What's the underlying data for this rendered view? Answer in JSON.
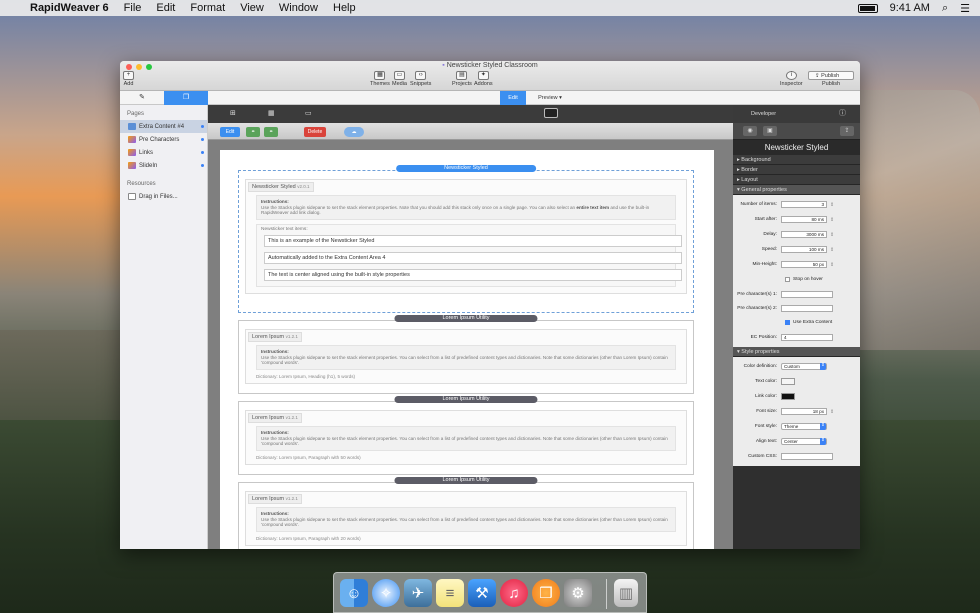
{
  "menubar": {
    "app": "RapidWeaver 6",
    "items": [
      "File",
      "Edit",
      "Format",
      "View",
      "Window",
      "Help"
    ],
    "clock": "9:41 AM"
  },
  "window": {
    "title": "Newsticker Styled Classroom",
    "toolbar": {
      "add": "Add",
      "themes": "Themes",
      "media": "Media",
      "snippets": "Snippets",
      "projects": "Projects",
      "addons": "Addons",
      "inspector": "Inspector",
      "publish": "Publish",
      "publish_button": "Publish"
    },
    "mode_tabs": {
      "edit": "Edit",
      "preview": "Preview"
    }
  },
  "sidebar": {
    "pages_header": "Pages",
    "pages": [
      {
        "label": "Extra Content #4",
        "color": "#5b8fd6"
      },
      {
        "label": "Pre Characters",
        "color": "#8b5cf6"
      },
      {
        "label": "Links",
        "color": "#8b5cf6"
      },
      {
        "label": "SlideIn",
        "color": "#8b5cf6"
      }
    ],
    "resources_header": "Resources",
    "drag_in": "Drag in Files..."
  },
  "stacks_toolbar": {
    "edit": "Edit",
    "delete": "Delete"
  },
  "stacks": [
    {
      "label": "Newsticker Styled",
      "title": "Newsticker Styled",
      "version": "v2.0.1",
      "instr_head": "Instructions:",
      "instr_1": "Use the Stacks plugin sidepane to set the stack element properties. Note that you should add this stack only once on a single page. You can also select an ",
      "instr_bold": "entire text item",
      "instr_2": " and use the built-in RapidWeaver add link dialog.",
      "items_head": "Newsticker text items:",
      "items": [
        "This is an example of the Newsticker Styled",
        "Automatically added to the Extra Content Area 4",
        "The text is center aligned using the built-in style properties"
      ]
    },
    {
      "label": "Lorem Ipsum Utility",
      "title": "Lorem Ipsum",
      "version": "v1.2.1",
      "instr_head": "Instructions:",
      "instr": "Use the Stacks plugin sidepane to set the stack element properties. You can select from a list of predefined content types and dictionaries. Note that some dictionaries (other than Lorem Ipsum) contain 'compound words'.",
      "dict": "Dictionary: Lorem Ipsum, Heading (h1), 5 words)"
    },
    {
      "label": "Lorem Ipsum Utility",
      "title": "Lorem Ipsum",
      "version": "v1.2.1",
      "instr_head": "Instructions:",
      "instr": "Use the Stacks plugin sidepane to set the stack element properties. You can select from a list of predefined content types and dictionaries. Note that some dictionaries (other than Lorem Ipsum) contain 'compound words'.",
      "dict": "Dictionary: Lorem Ipsum, Paragraph with 50 words)"
    },
    {
      "label": "Lorem Ipsum Utility",
      "title": "Lorem Ipsum",
      "version": "v1.2.1",
      "instr_head": "Instructions:",
      "instr": "Use the Stacks plugin sidepane to set the stack element properties. You can select from a list of predefined content types and dictionaries. Note that some dictionaries (other than Lorem Ipsum) contain 'compound words'.",
      "dict": "Dictionary: Lorem Ipsum, Paragraph with 20 words)"
    }
  ],
  "inspector": {
    "header": "Developer",
    "title": "Newsticker Styled",
    "sections": [
      "Background",
      "Border",
      "Layout",
      "General properties"
    ],
    "general": {
      "items_label": "Number of items:",
      "items": "3",
      "start_label": "Start after:",
      "start": "80 ms",
      "delay_label": "Delay:",
      "delay": "3000 ms",
      "speed_label": "Speed:",
      "speed": "100 ms",
      "minh_label": "Min-Height:",
      "minh": "50 px",
      "stop_hover": "Stop on hover",
      "pre1_label": "Pre character(s) 1:",
      "pre2_label": "Pre character(s) 2:",
      "use_extra": "Use Extra Content",
      "ec_label": "EC Position:",
      "ec": "4"
    },
    "style_section": "Style properties",
    "style": {
      "colordef_label": "Color definition:",
      "colordef": "Custom",
      "textcolor_label": "Text color:",
      "linkcolor_label": "Link color:",
      "fontsize_label": "Font size:",
      "fontsize": "18 px",
      "fontstyle_label": "Font style:",
      "fontstyle": "Theme",
      "align_label": "Align text:",
      "align": "Center",
      "css_label": "Custom CSS:"
    }
  },
  "dock": [
    "finder-icon",
    "safari-icon",
    "preview-icon",
    "notes-icon",
    "xcode-icon",
    "itunes-icon",
    "ibooks-icon",
    "system-preferences-icon",
    "trash-icon"
  ]
}
